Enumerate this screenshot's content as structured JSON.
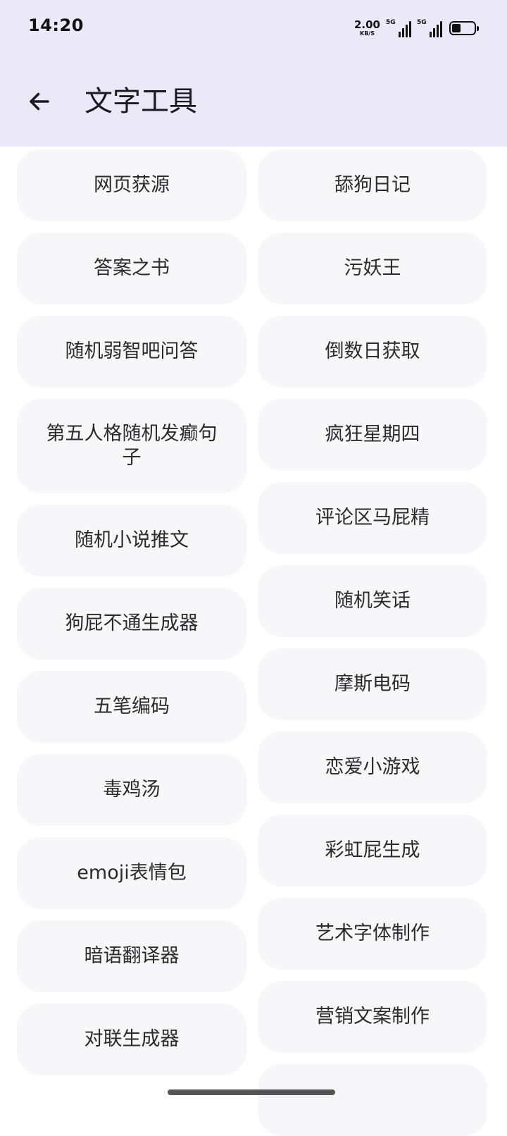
{
  "status_bar": {
    "time": "14:20",
    "net_speed_value": "2.00",
    "net_speed_unit": "KB/S",
    "signal1_label": "5G",
    "signal2_label": "5G",
    "battery_level": 0.4
  },
  "header": {
    "back_icon": "arrow-left-icon",
    "title": "文字工具",
    "background": "#ebe8f8"
  },
  "tools": {
    "left": [
      "网页获源",
      "答案之书",
      "随机弱智吧问答",
      "第五人格随机发癫句子",
      "随机小说推文",
      "狗屁不通生成器",
      "五笔编码",
      "毒鸡汤",
      "emoji表情包",
      "暗语翻译器",
      "对联生成器"
    ],
    "right": [
      "舔狗日记",
      "污妖王",
      "倒数日获取",
      "疯狂星期四",
      "评论区马屁精",
      "随机笑话",
      "摩斯电码",
      "恋爱小游戏",
      "彩虹屁生成",
      "艺术字体制作",
      "营销文案制作",
      ""
    ]
  }
}
